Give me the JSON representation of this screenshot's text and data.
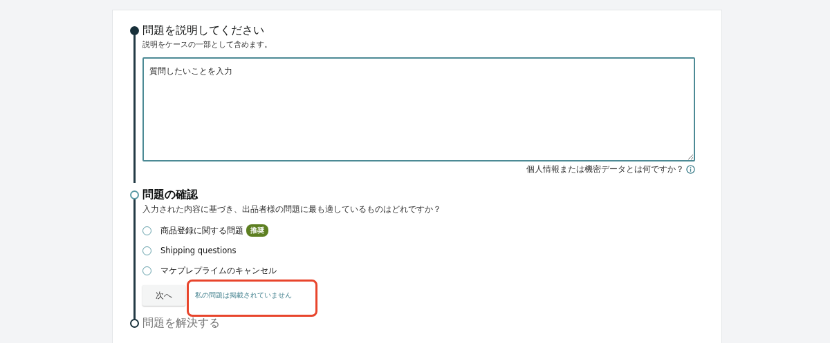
{
  "steps": [
    {
      "kind": "describe",
      "completed": true,
      "current": false,
      "title": "問題を説明してください",
      "subtitle": "説明をケースの一部として含めます。",
      "field": {
        "placeholder": "質問したいことを入力"
      },
      "help_link": "個人情報または機密データとは何ですか？"
    },
    {
      "kind": "confirm",
      "completed": false,
      "current": true,
      "title": "問題の確認",
      "question": "入力された内容に基づき、出品者様の問題に最も適しているものはどれですか？",
      "options": [
        {
          "label": "商品登録に関する問題",
          "badge": "推奨",
          "selected": false
        },
        {
          "label": "Shipping questions",
          "selected": false
        },
        {
          "label": "マケプレプライムのキャンセル",
          "selected": false
        }
      ],
      "next_button": "次へ",
      "not_listed_link": "私の問題は掲載されていません",
      "highlight": true
    },
    {
      "kind": "resolve",
      "completed": false,
      "current": false,
      "title": "問題を解決する"
    }
  ]
}
